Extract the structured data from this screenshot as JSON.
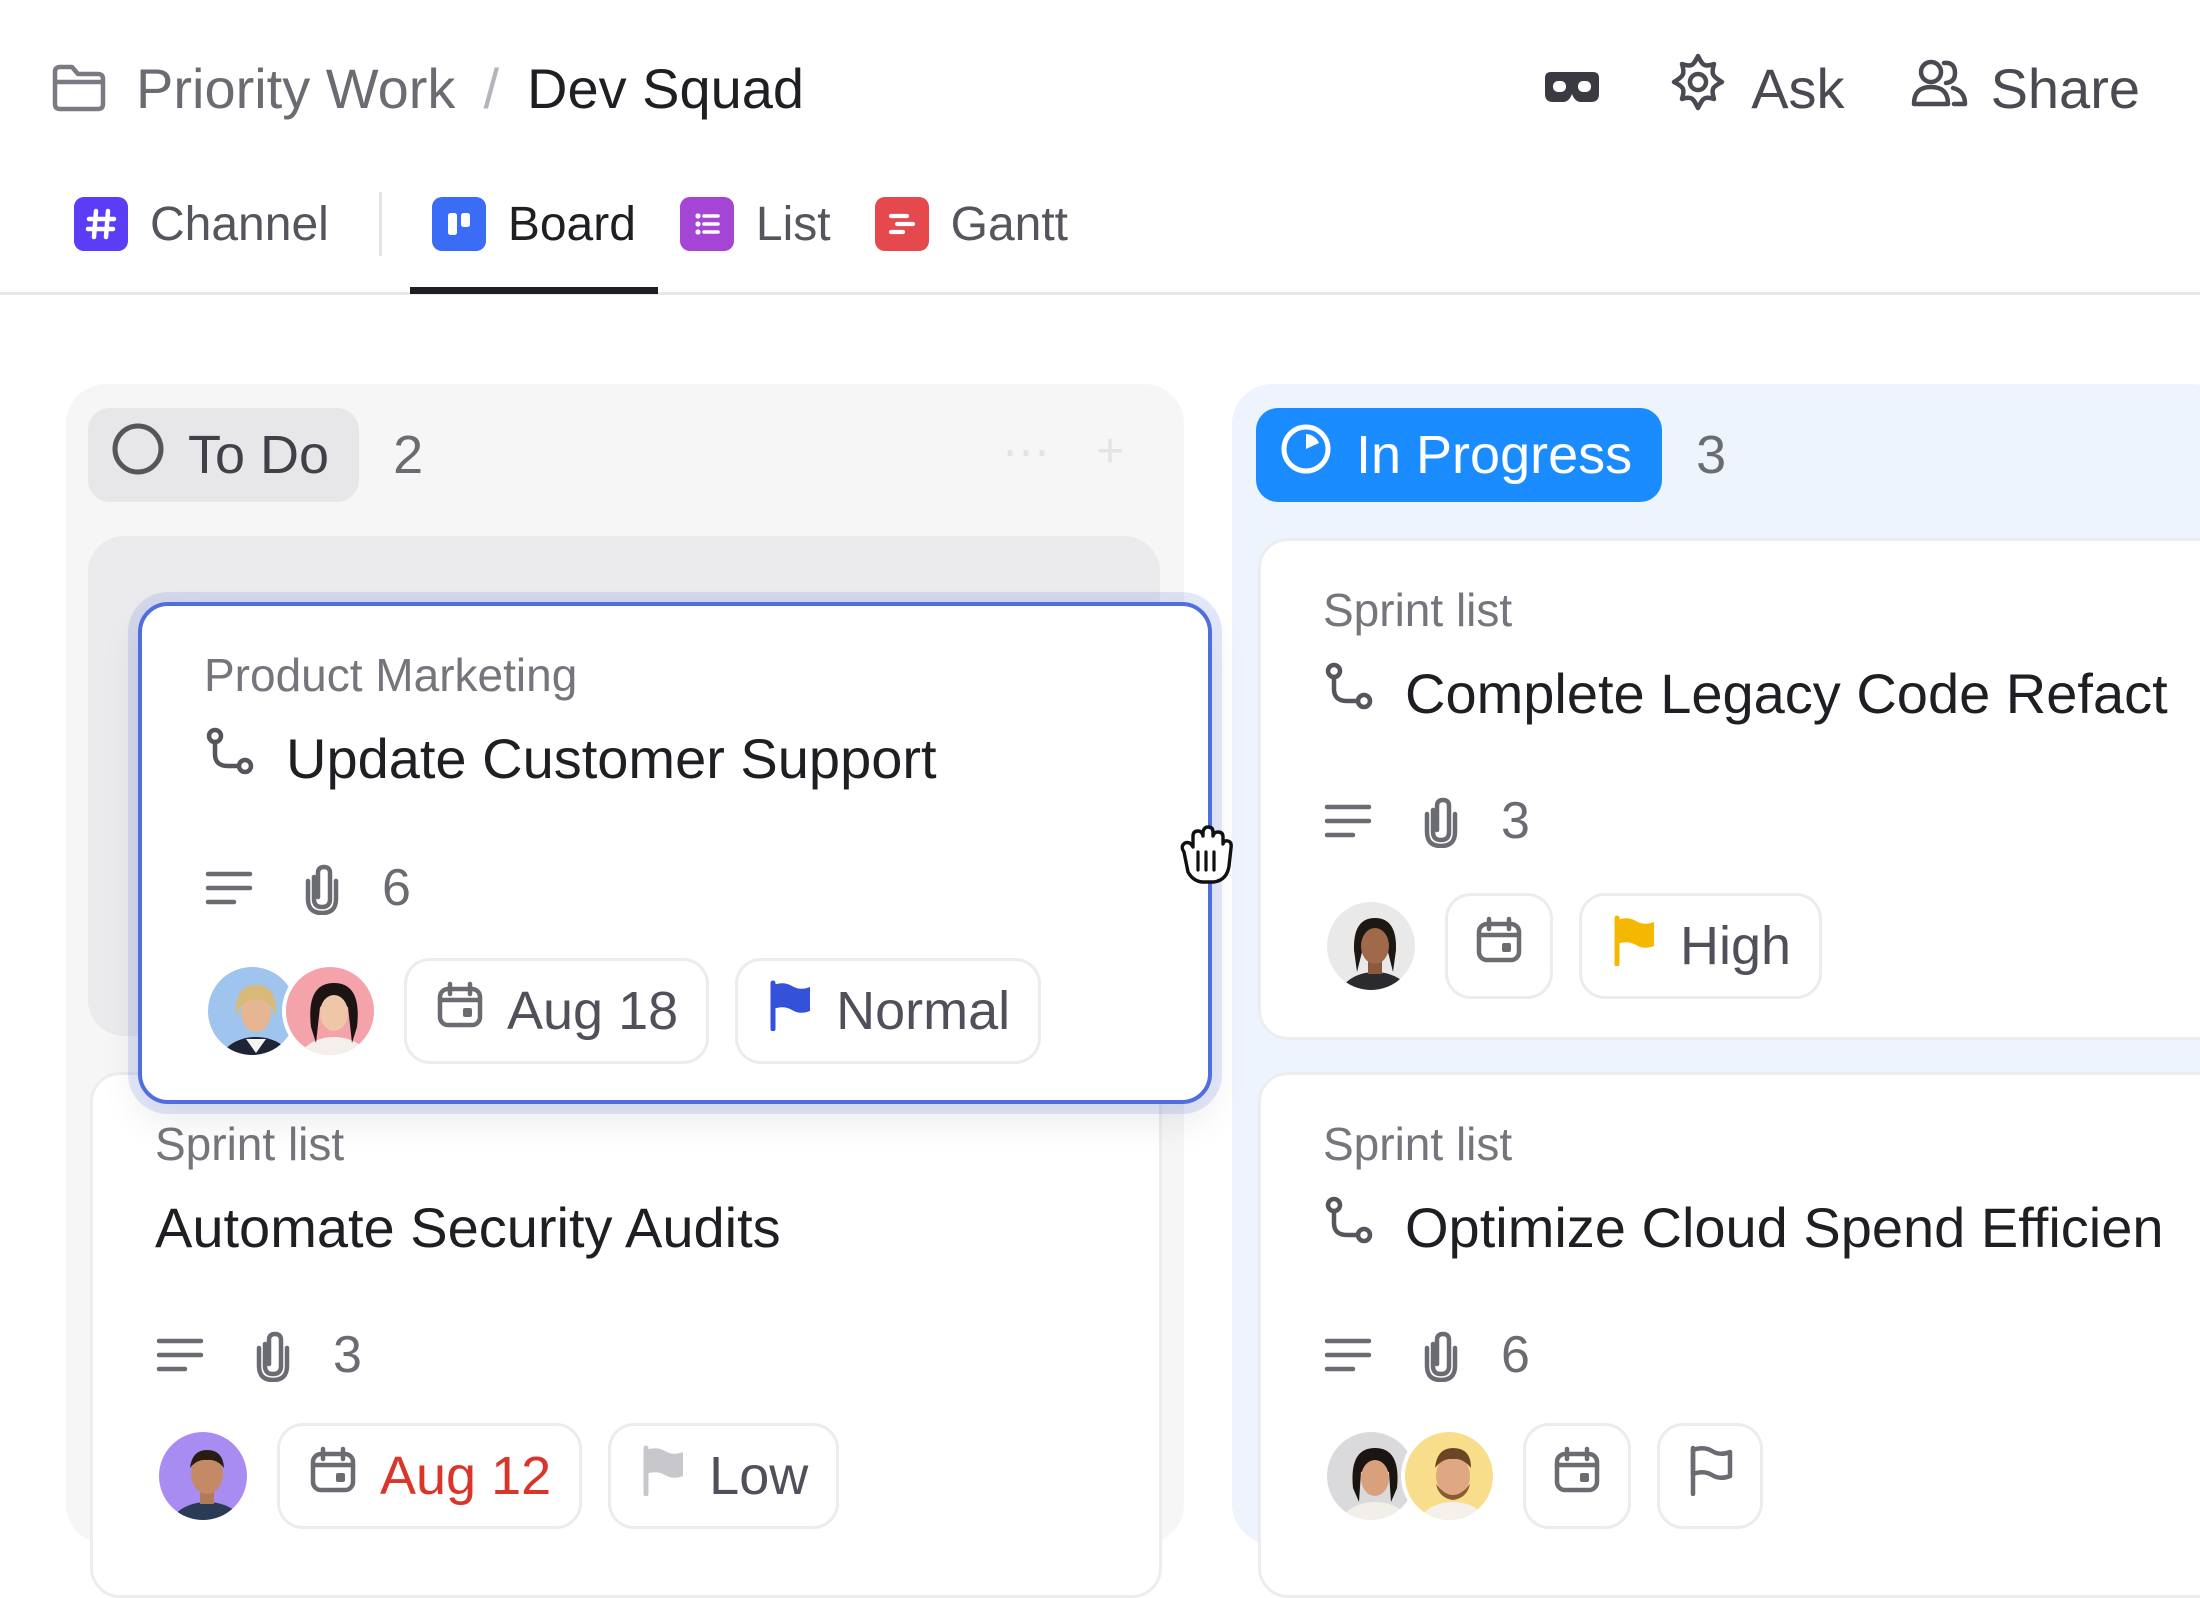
{
  "breadcrumb": {
    "parent": "Priority Work",
    "separator": "/",
    "current": "Dev Squad"
  },
  "header_actions": {
    "ask_label": "Ask",
    "share_label": "Share"
  },
  "views": [
    {
      "label": "Channel",
      "icon": "hash-icon",
      "color": "#5b3df5"
    },
    {
      "label": "Board",
      "icon": "board-icon",
      "color": "#3b6cf5",
      "active": true
    },
    {
      "label": "List",
      "icon": "list-icon",
      "color": "#a445d6"
    },
    {
      "label": "Gantt",
      "icon": "gantt-icon",
      "color": "#e5484d"
    }
  ],
  "columns": [
    {
      "status": "To Do",
      "count": "2",
      "color": "#e7e7e9",
      "cards": [
        {
          "list": "Product Marketing",
          "title": "Update Customer Support",
          "attachments": "6",
          "assignees": [
            "avatar-blonde-person",
            "avatar-dark-hair-person"
          ],
          "due": "Aug 18",
          "priority": "Normal",
          "priority_color": "#3452d9",
          "dragging": true
        },
        {
          "list": "Sprint list",
          "title": "Automate Security Audits",
          "attachments": "3",
          "assignees": [
            "avatar-purple-bg-person"
          ],
          "due": "Aug 12",
          "due_color": "#d9352a",
          "priority": "Low",
          "priority_color": "#c8c8cc"
        }
      ]
    },
    {
      "status": "In Progress",
      "count": "3",
      "color": "#1a8cff",
      "cards": [
        {
          "list": "Sprint list",
          "title": "Complete Legacy Code Refact",
          "attachments": "3",
          "assignees": [
            "avatar-long-hair-person"
          ],
          "due": "",
          "priority": "High",
          "priority_color": "#f5b800"
        },
        {
          "list": "Sprint list",
          "title": "Optimize Cloud Spend Efficien",
          "attachments": "6",
          "assignees": [
            "avatar-woman",
            "avatar-bearded-man"
          ],
          "due": "",
          "priority": ""
        }
      ]
    }
  ]
}
